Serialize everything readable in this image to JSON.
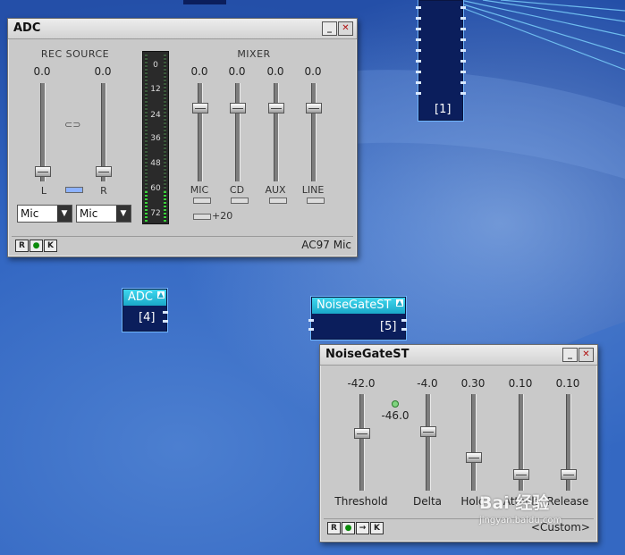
{
  "adc_window": {
    "title": "ADC",
    "rec_source_label": "REC SOURCE",
    "left_value": "0.0",
    "right_value": "0.0",
    "left_label": "L",
    "right_label": "R",
    "left_select": "Mic",
    "right_select": "Mic",
    "meter_ticks": [
      "0",
      "12",
      "24",
      "36",
      "48",
      "60",
      "72"
    ],
    "mixer_label": "MIXER",
    "mixer_channels": [
      {
        "label": "MIC",
        "value": "0.0"
      },
      {
        "label": "CD",
        "value": "0.0"
      },
      {
        "label": "AUX",
        "value": "0.0"
      },
      {
        "label": "LINE",
        "value": "0.0"
      }
    ],
    "boost_label": "+20",
    "status_buttons": [
      "R",
      "●",
      "K"
    ],
    "status_text": "AC97 Mic"
  },
  "adc_module": {
    "title": "ADC",
    "number": "[4]"
  },
  "noisegate_module": {
    "title": "NoiseGateST",
    "number": "[5]"
  },
  "top_module": {
    "number": "[1]"
  },
  "noisegate_window": {
    "title": "NoiseGateST",
    "indicator_value": "-46.0",
    "params": [
      {
        "label": "Threshold",
        "value": "-42.0"
      },
      {
        "label": "Delta",
        "value": "-4.0"
      },
      {
        "label": "Hold",
        "value": "0.30"
      },
      {
        "label": "Attack",
        "value": "0.10"
      },
      {
        "label": "Release",
        "value": "0.10"
      }
    ],
    "status_buttons": [
      "R",
      "●",
      "→",
      "K"
    ],
    "status_text": "<Custom>"
  },
  "watermark": {
    "text": "Bai 经验",
    "sub": "jingyan.baidu.com"
  }
}
